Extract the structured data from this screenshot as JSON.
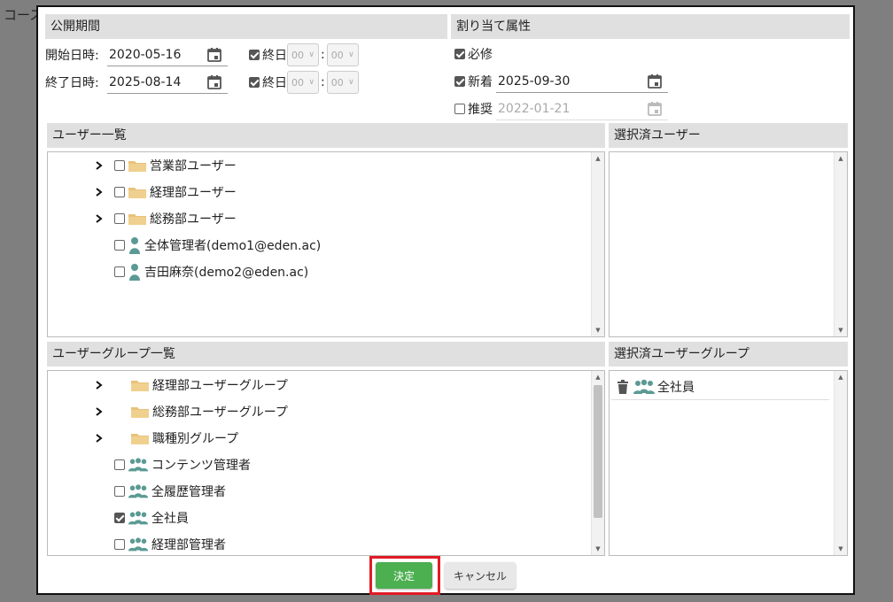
{
  "background": {
    "title": "コース"
  },
  "publish_period": {
    "header": "公開期間",
    "start": {
      "label": "開始日時:",
      "date": "2020-05-16",
      "allday_label": "終日",
      "allday_checked": true,
      "hour": "00",
      "minute": "00"
    },
    "end": {
      "label": "終了日時:",
      "date": "2025-08-14",
      "allday_label": "終日",
      "allday_checked": true,
      "hour": "00",
      "minute": "00"
    },
    "colon": ":"
  },
  "attributes": {
    "header": "割り当て属性",
    "required": {
      "label": "必修",
      "checked": true
    },
    "new": {
      "label": "新着",
      "checked": true,
      "date": "2025-09-30"
    },
    "recommended": {
      "label": "推奨",
      "checked": false,
      "date": "2022-01-21",
      "disabled": true
    }
  },
  "user_list": {
    "header": "ユーザー一覧",
    "items": [
      {
        "label": "営業部ユーザー",
        "type": "folder",
        "expandable": true,
        "checked": false
      },
      {
        "label": "経理部ユーザー",
        "type": "folder",
        "expandable": true,
        "checked": false
      },
      {
        "label": "総務部ユーザー",
        "type": "folder",
        "expandable": true,
        "checked": false
      },
      {
        "label": "全体管理者(demo1@eden.ac)",
        "type": "user",
        "expandable": false,
        "checked": false
      },
      {
        "label": "吉田麻奈(demo2@eden.ac)",
        "type": "user",
        "expandable": false,
        "checked": false
      }
    ]
  },
  "selected_users": {
    "header": "選択済ユーザー"
  },
  "group_list": {
    "header": "ユーザーグループ一覧",
    "items": [
      {
        "label": "経理部ユーザーグループ",
        "type": "folder",
        "expandable": true
      },
      {
        "label": "総務部ユーザーグループ",
        "type": "folder",
        "expandable": true
      },
      {
        "label": "職種別グループ",
        "type": "folder",
        "expandable": true
      },
      {
        "label": "コンテンツ管理者",
        "type": "group",
        "checked": false
      },
      {
        "label": "全履歴管理者",
        "type": "group",
        "checked": false
      },
      {
        "label": "全社員",
        "type": "group",
        "checked": true
      },
      {
        "label": "経理部管理者",
        "type": "group",
        "checked": false
      }
    ]
  },
  "selected_groups": {
    "header": "選択済ユーザーグループ",
    "items": [
      {
        "label": "全社員"
      }
    ]
  },
  "buttons": {
    "ok": "決定",
    "cancel": "キャンセル"
  },
  "colors": {
    "ok_green": "#4caf50",
    "highlight_red": "#e01b24",
    "header_gray": "#e0e0e0",
    "folder": "#e8c27a",
    "person_teal": "#5b9a94"
  }
}
